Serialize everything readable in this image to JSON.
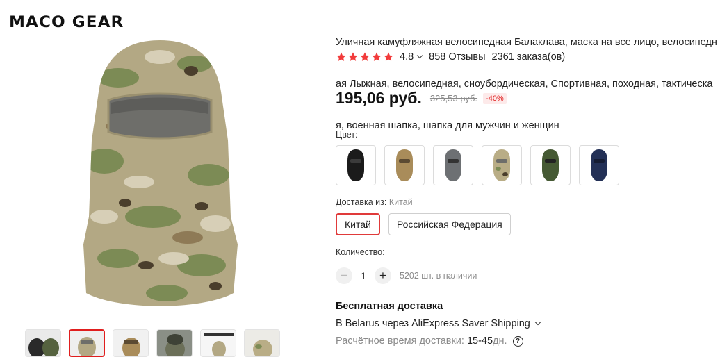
{
  "brand": {
    "logo_text": "MACO GEAR"
  },
  "product": {
    "title_lines": [
      "Уличная камуфляжная велосипедная Балаклава, маска на все лицо, велосипедн",
      "ая Лыжная, велосипедная, сноубордическая, Спортивная, походная, тактическа",
      "я, военная шапка, шапка для мужчин и женщин"
    ],
    "rating": "4.8",
    "stars": 5,
    "reviews": "858 Отзывы",
    "orders": "2361 заказа(ов)",
    "price": "195,06 руб.",
    "old_price": "325,53 руб.",
    "discount": "-40%"
  },
  "color": {
    "label": "Цвет:",
    "options": [
      {
        "icon": "balaclava-black-icon",
        "fill": "#1b1b1b"
      },
      {
        "icon": "balaclava-khaki-icon",
        "fill": "#a98c5a"
      },
      {
        "icon": "balaclava-gray-icon",
        "fill": "#6d7073"
      },
      {
        "icon": "balaclava-camo-icon",
        "fill": "#b9ad86"
      },
      {
        "icon": "balaclava-green-icon",
        "fill": "#465a34"
      },
      {
        "icon": "balaclava-navy-icon",
        "fill": "#233056"
      }
    ]
  },
  "shipping_from": {
    "label": "Доставка из:",
    "value": "Китай",
    "options": [
      {
        "label": "Китай",
        "selected": true
      },
      {
        "label": "Российская Федерация",
        "selected": false
      }
    ]
  },
  "quantity": {
    "label": "Количество:",
    "minus": "−",
    "plus": "+",
    "value": "1",
    "stock": "5202 шт. в наличии"
  },
  "delivery": {
    "free": "Бесплатная доставка",
    "method": "В Belarus через AliExpress Saver Shipping",
    "time_label": "Расчётное время доставки:",
    "time_value": "15-45",
    "time_unit": "дн.",
    "help": "?"
  },
  "colors": {
    "accent": "#e01e1e",
    "star": "#f23b3b"
  }
}
